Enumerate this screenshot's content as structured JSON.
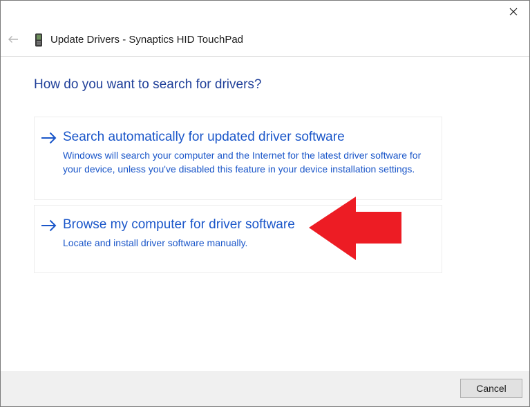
{
  "window": {
    "title": "Update Drivers - Synaptics HID TouchPad",
    "close_icon": "close-icon",
    "back_icon": "back-arrow-icon",
    "device_icon": "device-icon"
  },
  "main": {
    "question": "How do you want to search for drivers?",
    "options": [
      {
        "title": "Search automatically for updated driver software",
        "description": "Windows will search your computer and the Internet for the latest driver software for your device, unless you've disabled this feature in your device installation settings.",
        "icon": "right-arrow-icon"
      },
      {
        "title": "Browse my computer for driver software",
        "description": "Locate and install driver software manually.",
        "icon": "right-arrow-icon"
      }
    ],
    "annotation_icon": "red-pointer-arrow-icon"
  },
  "footer": {
    "cancel_label": "Cancel"
  },
  "colors": {
    "accent": "#1a56c9",
    "heading": "#1f3f99",
    "annotation": "#ed1c24",
    "footer_bg": "#f0f0f0"
  }
}
